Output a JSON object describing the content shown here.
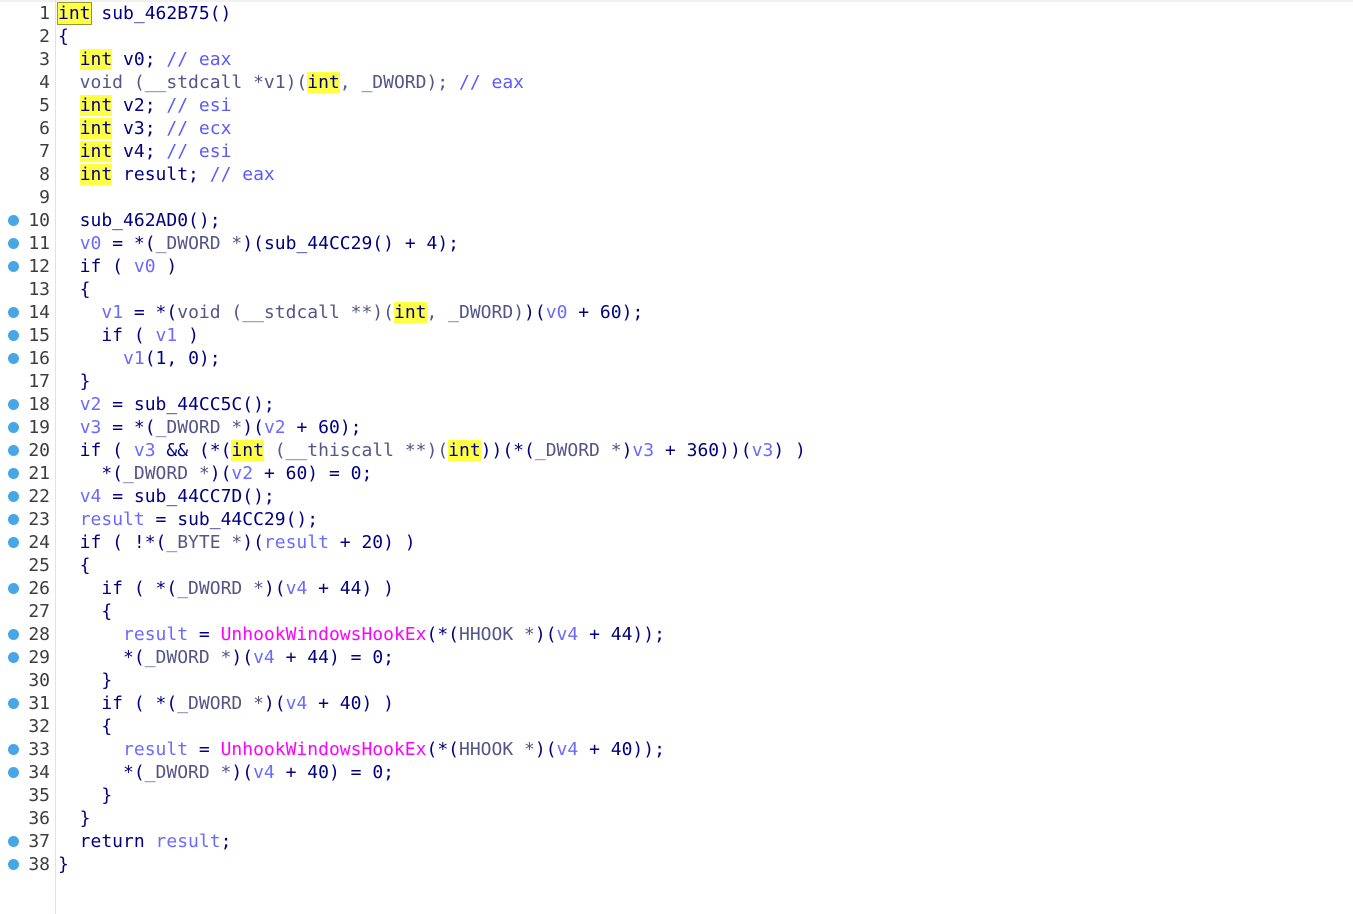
{
  "colors": {
    "keyword": "#000080",
    "variable": "#6a6aff",
    "comment": "#5a5aff",
    "import": "#ff00ff",
    "highlight": "#ffff44",
    "breakpoint": "#47a6e6"
  },
  "lines": [
    {
      "n": "1",
      "bp": false,
      "tokens": [
        {
          "t": "int",
          "c": "hi-cur"
        },
        {
          "t": " sub_462B75()",
          "c": "func"
        }
      ]
    },
    {
      "n": "2",
      "bp": false,
      "tokens": [
        {
          "t": "{",
          "c": "punc"
        }
      ]
    },
    {
      "n": "3",
      "bp": false,
      "tokens": [
        {
          "t": "  ",
          "c": "punc"
        },
        {
          "t": "int",
          "c": "hi"
        },
        {
          "t": " v0; ",
          "c": "punc"
        },
        {
          "t": "// eax",
          "c": "cmt"
        }
      ]
    },
    {
      "n": "4",
      "bp": false,
      "tokens": [
        {
          "t": "  void (__stdcall *v1)(",
          "c": "type"
        },
        {
          "t": "int",
          "c": "hi"
        },
        {
          "t": ", _DWORD); ",
          "c": "type"
        },
        {
          "t": "// eax",
          "c": "cmt"
        }
      ]
    },
    {
      "n": "5",
      "bp": false,
      "tokens": [
        {
          "t": "  ",
          "c": "punc"
        },
        {
          "t": "int",
          "c": "hi"
        },
        {
          "t": " v2; ",
          "c": "punc"
        },
        {
          "t": "// esi",
          "c": "cmt"
        }
      ]
    },
    {
      "n": "6",
      "bp": false,
      "tokens": [
        {
          "t": "  ",
          "c": "punc"
        },
        {
          "t": "int",
          "c": "hi"
        },
        {
          "t": " v3; ",
          "c": "punc"
        },
        {
          "t": "// ecx",
          "c": "cmt"
        }
      ]
    },
    {
      "n": "7",
      "bp": false,
      "tokens": [
        {
          "t": "  ",
          "c": "punc"
        },
        {
          "t": "int",
          "c": "hi"
        },
        {
          "t": " v4; ",
          "c": "punc"
        },
        {
          "t": "// esi",
          "c": "cmt"
        }
      ]
    },
    {
      "n": "8",
      "bp": false,
      "tokens": [
        {
          "t": "  ",
          "c": "punc"
        },
        {
          "t": "int",
          "c": "hi"
        },
        {
          "t": " result; ",
          "c": "punc"
        },
        {
          "t": "// eax",
          "c": "cmt"
        }
      ]
    },
    {
      "n": "9",
      "bp": false,
      "tokens": []
    },
    {
      "n": "10",
      "bp": true,
      "tokens": [
        {
          "t": "  sub_462AD0();",
          "c": "func"
        }
      ]
    },
    {
      "n": "11",
      "bp": true,
      "tokens": [
        {
          "t": "  ",
          "c": "punc"
        },
        {
          "t": "v0",
          "c": "var"
        },
        {
          "t": " = *(",
          "c": "punc"
        },
        {
          "t": "_DWORD *",
          "c": "type"
        },
        {
          "t": ")(sub_44CC29() + 4);",
          "c": "punc"
        }
      ]
    },
    {
      "n": "12",
      "bp": true,
      "tokens": [
        {
          "t": "  if ( ",
          "c": "kw"
        },
        {
          "t": "v0",
          "c": "var"
        },
        {
          "t": " )",
          "c": "punc"
        }
      ]
    },
    {
      "n": "13",
      "bp": false,
      "tokens": [
        {
          "t": "  {",
          "c": "punc"
        }
      ]
    },
    {
      "n": "14",
      "bp": true,
      "tokens": [
        {
          "t": "    ",
          "c": "punc"
        },
        {
          "t": "v1",
          "c": "var"
        },
        {
          "t": " = *(",
          "c": "punc"
        },
        {
          "t": "void (__stdcall **)(",
          "c": "type"
        },
        {
          "t": "int",
          "c": "hi"
        },
        {
          "t": ", _DWORD)",
          "c": "type"
        },
        {
          "t": ")(",
          "c": "punc"
        },
        {
          "t": "v0",
          "c": "var"
        },
        {
          "t": " + 60);",
          "c": "punc"
        }
      ]
    },
    {
      "n": "15",
      "bp": true,
      "tokens": [
        {
          "t": "    if ( ",
          "c": "kw"
        },
        {
          "t": "v1",
          "c": "var"
        },
        {
          "t": " )",
          "c": "punc"
        }
      ]
    },
    {
      "n": "16",
      "bp": true,
      "tokens": [
        {
          "t": "      ",
          "c": "punc"
        },
        {
          "t": "v1",
          "c": "var"
        },
        {
          "t": "(1, 0);",
          "c": "punc"
        }
      ]
    },
    {
      "n": "17",
      "bp": false,
      "tokens": [
        {
          "t": "  }",
          "c": "punc"
        }
      ]
    },
    {
      "n": "18",
      "bp": true,
      "tokens": [
        {
          "t": "  ",
          "c": "punc"
        },
        {
          "t": "v2",
          "c": "var"
        },
        {
          "t": " = sub_44CC5C();",
          "c": "punc"
        }
      ]
    },
    {
      "n": "19",
      "bp": true,
      "tokens": [
        {
          "t": "  ",
          "c": "punc"
        },
        {
          "t": "v3",
          "c": "var"
        },
        {
          "t": " = *(",
          "c": "punc"
        },
        {
          "t": "_DWORD *",
          "c": "type"
        },
        {
          "t": ")(",
          "c": "punc"
        },
        {
          "t": "v2",
          "c": "var"
        },
        {
          "t": " + 60);",
          "c": "punc"
        }
      ]
    },
    {
      "n": "20",
      "bp": true,
      "tokens": [
        {
          "t": "  if ( ",
          "c": "kw"
        },
        {
          "t": "v3",
          "c": "var"
        },
        {
          "t": " && (*(",
          "c": "punc"
        },
        {
          "t": "int",
          "c": "hi"
        },
        {
          "t": " (__thiscall **)(",
          "c": "type"
        },
        {
          "t": "int",
          "c": "hi"
        },
        {
          "t": "))(*(",
          "c": "punc"
        },
        {
          "t": "_DWORD *",
          "c": "type"
        },
        {
          "t": ")",
          "c": "punc"
        },
        {
          "t": "v3",
          "c": "var"
        },
        {
          "t": " + 360))(",
          "c": "punc"
        },
        {
          "t": "v3",
          "c": "var"
        },
        {
          "t": ") )",
          "c": "punc"
        }
      ]
    },
    {
      "n": "21",
      "bp": true,
      "tokens": [
        {
          "t": "    *(",
          "c": "punc"
        },
        {
          "t": "_DWORD *",
          "c": "type"
        },
        {
          "t": ")(",
          "c": "punc"
        },
        {
          "t": "v2",
          "c": "var"
        },
        {
          "t": " + 60) = 0;",
          "c": "punc"
        }
      ]
    },
    {
      "n": "22",
      "bp": true,
      "tokens": [
        {
          "t": "  ",
          "c": "punc"
        },
        {
          "t": "v4",
          "c": "var"
        },
        {
          "t": " = sub_44CC7D();",
          "c": "punc"
        }
      ]
    },
    {
      "n": "23",
      "bp": true,
      "tokens": [
        {
          "t": "  ",
          "c": "punc"
        },
        {
          "t": "result",
          "c": "var"
        },
        {
          "t": " = sub_44CC29();",
          "c": "punc"
        }
      ]
    },
    {
      "n": "24",
      "bp": true,
      "tokens": [
        {
          "t": "  if ( !*(",
          "c": "kw"
        },
        {
          "t": "_BYTE *",
          "c": "type"
        },
        {
          "t": ")(",
          "c": "punc"
        },
        {
          "t": "result",
          "c": "var"
        },
        {
          "t": " + 20) )",
          "c": "punc"
        }
      ]
    },
    {
      "n": "25",
      "bp": false,
      "tokens": [
        {
          "t": "  {",
          "c": "punc"
        }
      ]
    },
    {
      "n": "26",
      "bp": true,
      "tokens": [
        {
          "t": "    if ( *(",
          "c": "kw"
        },
        {
          "t": "_DWORD *",
          "c": "type"
        },
        {
          "t": ")(",
          "c": "punc"
        },
        {
          "t": "v4",
          "c": "var"
        },
        {
          "t": " + 44) )",
          "c": "punc"
        }
      ]
    },
    {
      "n": "27",
      "bp": false,
      "tokens": [
        {
          "t": "    {",
          "c": "punc"
        }
      ]
    },
    {
      "n": "28",
      "bp": true,
      "tokens": [
        {
          "t": "      ",
          "c": "punc"
        },
        {
          "t": "result",
          "c": "var"
        },
        {
          "t": " = ",
          "c": "punc"
        },
        {
          "t": "UnhookWindowsHookEx",
          "c": "import"
        },
        {
          "t": "(*(",
          "c": "punc"
        },
        {
          "t": "HHOOK *",
          "c": "type"
        },
        {
          "t": ")(",
          "c": "punc"
        },
        {
          "t": "v4",
          "c": "var"
        },
        {
          "t": " + 44));",
          "c": "punc"
        }
      ]
    },
    {
      "n": "29",
      "bp": true,
      "tokens": [
        {
          "t": "      *(",
          "c": "punc"
        },
        {
          "t": "_DWORD *",
          "c": "type"
        },
        {
          "t": ")(",
          "c": "punc"
        },
        {
          "t": "v4",
          "c": "var"
        },
        {
          "t": " + 44) = 0;",
          "c": "punc"
        }
      ]
    },
    {
      "n": "30",
      "bp": false,
      "tokens": [
        {
          "t": "    }",
          "c": "punc"
        }
      ]
    },
    {
      "n": "31",
      "bp": true,
      "tokens": [
        {
          "t": "    if ( *(",
          "c": "kw"
        },
        {
          "t": "_DWORD *",
          "c": "type"
        },
        {
          "t": ")(",
          "c": "punc"
        },
        {
          "t": "v4",
          "c": "var"
        },
        {
          "t": " + 40) )",
          "c": "punc"
        }
      ]
    },
    {
      "n": "32",
      "bp": false,
      "tokens": [
        {
          "t": "    {",
          "c": "punc"
        }
      ]
    },
    {
      "n": "33",
      "bp": true,
      "tokens": [
        {
          "t": "      ",
          "c": "punc"
        },
        {
          "t": "result",
          "c": "var"
        },
        {
          "t": " = ",
          "c": "punc"
        },
        {
          "t": "UnhookWindowsHookEx",
          "c": "import"
        },
        {
          "t": "(*(",
          "c": "punc"
        },
        {
          "t": "HHOOK *",
          "c": "type"
        },
        {
          "t": ")(",
          "c": "punc"
        },
        {
          "t": "v4",
          "c": "var"
        },
        {
          "t": " + 40));",
          "c": "punc"
        }
      ]
    },
    {
      "n": "34",
      "bp": true,
      "tokens": [
        {
          "t": "      *(",
          "c": "punc"
        },
        {
          "t": "_DWORD *",
          "c": "type"
        },
        {
          "t": ")(",
          "c": "punc"
        },
        {
          "t": "v4",
          "c": "var"
        },
        {
          "t": " + 40) = 0;",
          "c": "punc"
        }
      ]
    },
    {
      "n": "35",
      "bp": false,
      "tokens": [
        {
          "t": "    }",
          "c": "punc"
        }
      ]
    },
    {
      "n": "36",
      "bp": false,
      "tokens": [
        {
          "t": "  }",
          "c": "punc"
        }
      ]
    },
    {
      "n": "37",
      "bp": true,
      "tokens": [
        {
          "t": "  return ",
          "c": "kw"
        },
        {
          "t": "result",
          "c": "var"
        },
        {
          "t": ";",
          "c": "punc"
        }
      ]
    },
    {
      "n": "38",
      "bp": true,
      "tokens": [
        {
          "t": "}",
          "c": "punc"
        }
      ]
    }
  ]
}
